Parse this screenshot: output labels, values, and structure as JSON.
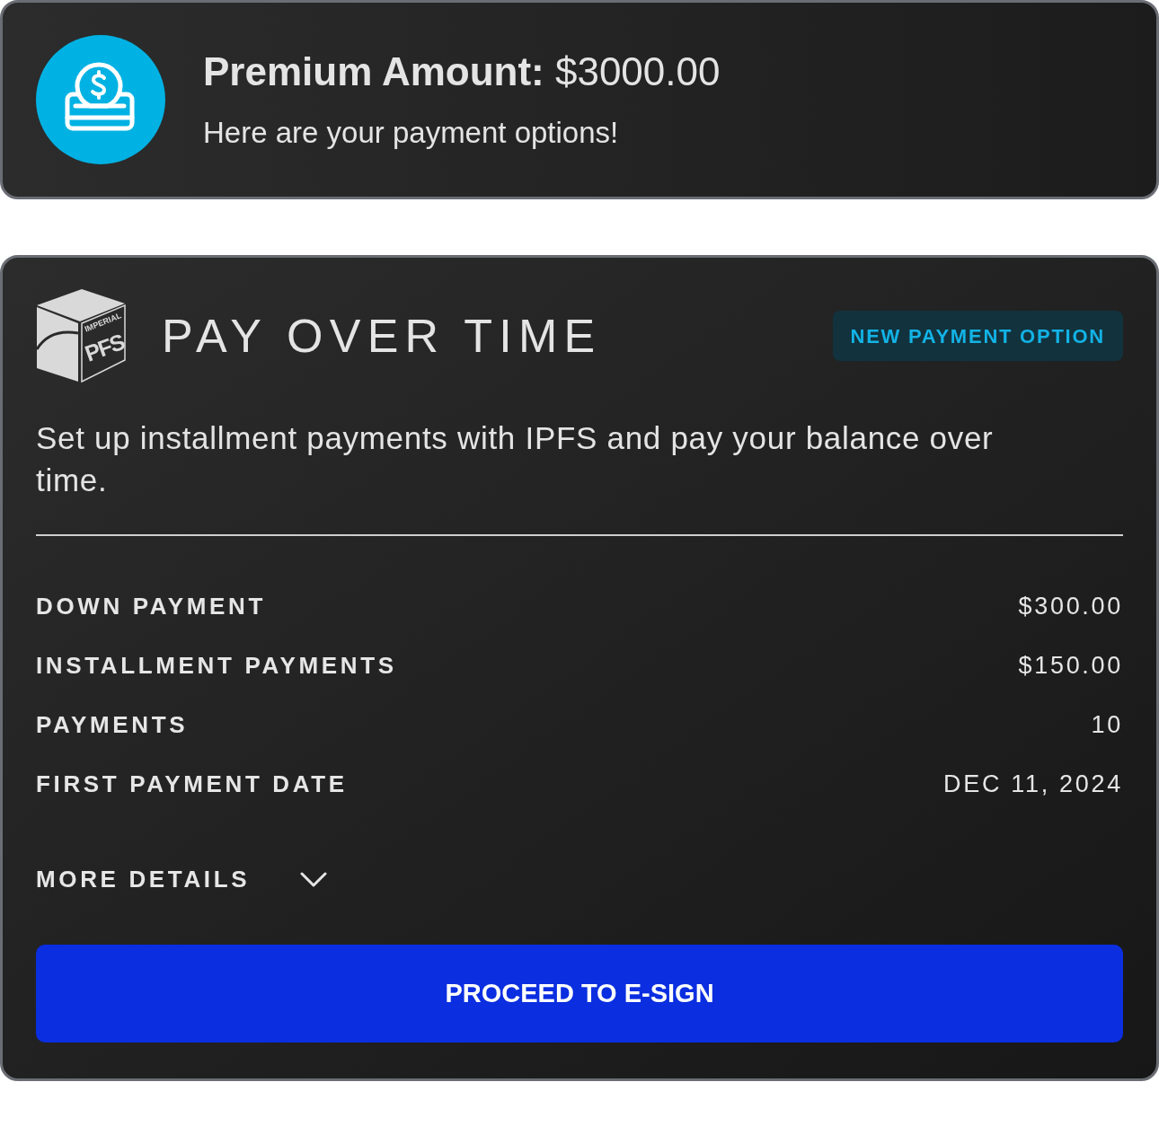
{
  "summary": {
    "title": "**Premium Amount:** $3000.00",
    "subtitle": "Here are your payment options!"
  },
  "plan": {
    "logo": {
      "small_text": "IMPERIAL",
      "text": "PFS"
    },
    "title": "PAY OVER TIME",
    "badge": "NEW PAYMENT OPTION",
    "description": "Set up installment payments with IPFS and pay your balance over time.",
    "rows": [
      {
        "label": "DOWN PAYMENT",
        "value": "$300.00"
      },
      {
        "label": "INSTALLMENT PAYMENTS",
        "value": "$150.00"
      },
      {
        "label": "PAYMENTS",
        "value": "10"
      },
      {
        "label": "FIRST PAYMENT DATE",
        "value": "DEC 11, 2024"
      }
    ],
    "more_details": {
      "label": "MORE DETAILS",
      "expanded": false
    },
    "button": "PROCEED TO E-SIGN"
  }
}
